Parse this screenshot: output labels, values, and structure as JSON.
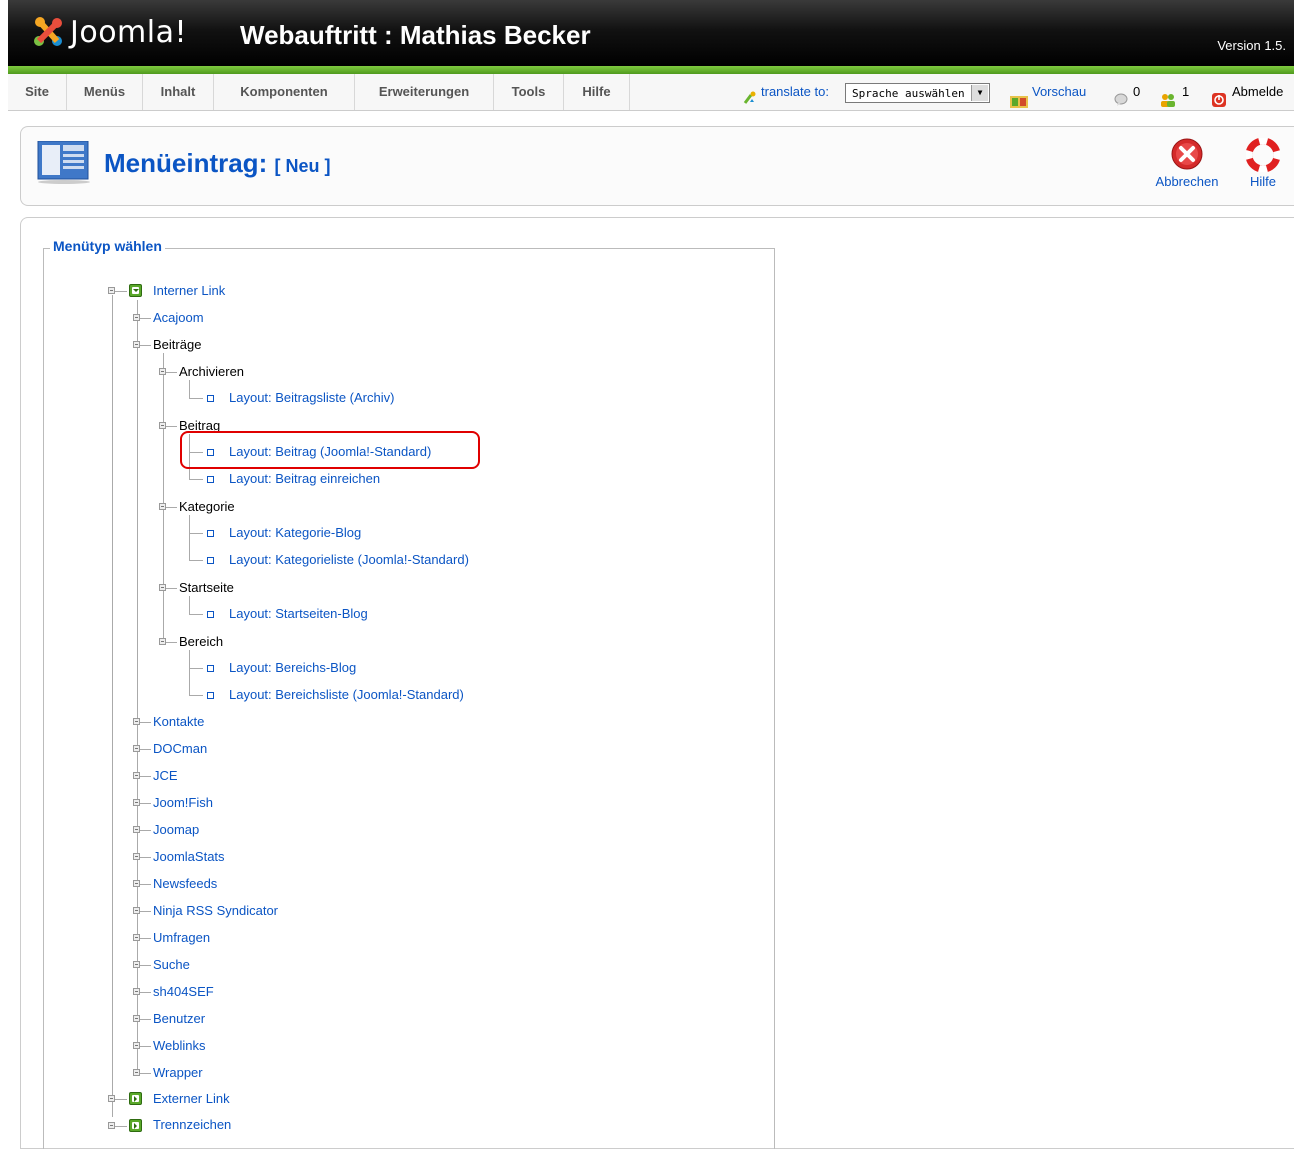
{
  "header": {
    "logo_text": "Joomla!",
    "site_title": "Webauftritt : Mathias Becker",
    "version": "Version 1.5."
  },
  "menubar": {
    "items": [
      "Site",
      "Menüs",
      "Inhalt",
      "Komponenten",
      "Erweiterungen",
      "Tools",
      "Hilfe"
    ],
    "translate_label": "translate to:",
    "language_select": "Sprache auswählen",
    "preview": "Vorschau",
    "messages_count": "0",
    "users_count": "1",
    "logout": "Abmelde"
  },
  "toolbar": {
    "title": "Menüeintrag:",
    "subtitle": "[ Neu ]",
    "cancel_label": "Abbrechen",
    "help_label": "Hilfe"
  },
  "content": {
    "legend": "Menütyp wählen",
    "tree": {
      "internal_link": "Interner Link",
      "acajoom": "Acajoom",
      "beitraege": "Beiträge",
      "archivieren": "Archivieren",
      "layout_archiv": "Layout: Beitragsliste (Archiv)",
      "beitrag": "Beitrag",
      "layout_beitrag_std": "Layout: Beitrag (Joomla!-Standard)",
      "layout_beitrag_einreichen": "Layout: Beitrag einreichen",
      "kategorie": "Kategorie",
      "layout_kat_blog": "Layout: Kategorie-Blog",
      "layout_kat_liste": "Layout: Kategorieliste (Joomla!-Standard)",
      "startseite": "Startseite",
      "layout_start_blog": "Layout: Startseiten-Blog",
      "bereich": "Bereich",
      "layout_bereich_blog": "Layout: Bereichs-Blog",
      "layout_bereich_liste": "Layout: Bereichsliste (Joomla!-Standard)",
      "components": [
        "Kontakte",
        "DOCman",
        "JCE",
        "Joom!Fish",
        "Joomap",
        "JoomlaStats",
        "Newsfeeds",
        "Ninja RSS Syndicator",
        "Umfragen",
        "Suche",
        "sh404SEF",
        "Benutzer",
        "Weblinks",
        "Wrapper"
      ],
      "external_link": "Externer Link",
      "separator": "Trennzeichen"
    }
  },
  "colors": {
    "link": "#0b55c4",
    "header_bg": "#000000",
    "accent_green": "#6ab52f",
    "highlight_red": "#e00000"
  }
}
